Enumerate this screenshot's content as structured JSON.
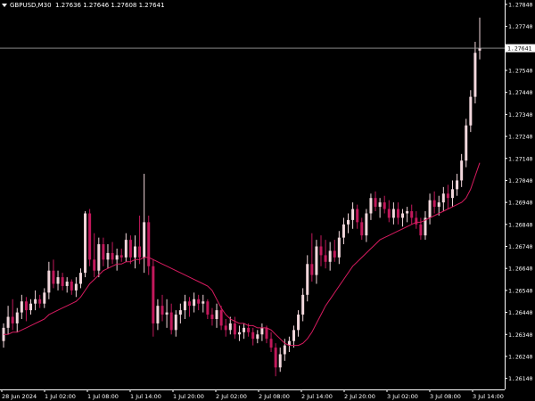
{
  "header": {
    "symbol": "GBPUSD,M30",
    "ohlc": [
      "1.27636",
      "1.27646",
      "1.27608",
      "1.27641"
    ]
  },
  "colors": {
    "background": "#000000",
    "bull": "#f2d7dc",
    "bear": "#c2185b",
    "ma": "#d81b60",
    "axis": "#ffffff",
    "priceline": "#9e9e9e"
  },
  "chart_data": {
    "type": "candlestick",
    "ylim": [
      1.2609,
      1.2786
    ],
    "y_ticks": [
      "1.27840",
      "1.27740",
      "1.27641",
      "1.27540",
      "1.27440",
      "1.27340",
      "1.27240",
      "1.27140",
      "1.27040",
      "1.26940",
      "1.26840",
      "1.26740",
      "1.26640",
      "1.26540",
      "1.26440",
      "1.26340",
      "1.26240",
      "1.26140"
    ],
    "x_ticks": [
      "28 Jun 2024",
      "1 Jul 02:00",
      "1 Jul 08:00",
      "1 Jul 14:00",
      "1 Jul 20:00",
      "2 Jul 02:00",
      "2 Jul 08:00",
      "2 Jul 14:00",
      "2 Jul 20:00",
      "3 Jul 02:00",
      "3 Jul 08:00",
      "3 Jul 14:00"
    ],
    "current_price": "1.27641",
    "candles": [
      [
        1.2631,
        1.2639,
        1.2628,
        1.2637
      ],
      [
        1.2637,
        1.2647,
        1.2634,
        1.2642
      ],
      [
        1.2642,
        1.265,
        1.2636,
        1.2639
      ],
      [
        1.2639,
        1.2646,
        1.2635,
        1.2644
      ],
      [
        1.2644,
        1.2652,
        1.2641,
        1.2649
      ],
      [
        1.2649,
        1.2651,
        1.264,
        1.2645
      ],
      [
        1.2645,
        1.265,
        1.2643,
        1.2648
      ],
      [
        1.2648,
        1.2654,
        1.2645,
        1.265
      ],
      [
        1.265,
        1.2652,
        1.2646,
        1.2648
      ],
      [
        1.2648,
        1.2655,
        1.2646,
        1.2653
      ],
      [
        1.2653,
        1.2667,
        1.265,
        1.2663
      ],
      [
        1.2663,
        1.2668,
        1.2655,
        1.2657
      ],
      [
        1.2657,
        1.2663,
        1.2654,
        1.266
      ],
      [
        1.266,
        1.2662,
        1.2654,
        1.2656
      ],
      [
        1.2656,
        1.266,
        1.2653,
        1.2658
      ],
      [
        1.2658,
        1.2659,
        1.2652,
        1.2654
      ],
      [
        1.2654,
        1.266,
        1.2651,
        1.2657
      ],
      [
        1.2657,
        1.2664,
        1.2655,
        1.2662
      ],
      [
        1.2662,
        1.269,
        1.266,
        1.2689
      ],
      [
        1.2689,
        1.2691,
        1.2665,
        1.2668
      ],
      [
        1.2668,
        1.268,
        1.266,
        1.2663
      ],
      [
        1.2663,
        1.2678,
        1.266,
        1.2675
      ],
      [
        1.2675,
        1.2678,
        1.2665,
        1.2668
      ],
      [
        1.2668,
        1.2675,
        1.2664,
        1.2671
      ],
      [
        1.2671,
        1.2676,
        1.2666,
        1.2668
      ],
      [
        1.2668,
        1.2673,
        1.2663,
        1.267
      ],
      [
        1.267,
        1.2673,
        1.2667,
        1.2669
      ],
      [
        1.2669,
        1.268,
        1.2667,
        1.2677
      ],
      [
        1.2677,
        1.2679,
        1.2666,
        1.2669
      ],
      [
        1.2669,
        1.2679,
        1.2664,
        1.2674
      ],
      [
        1.2674,
        1.2688,
        1.2666,
        1.2669
      ],
      [
        1.2669,
        1.2707,
        1.2662,
        1.2685
      ],
      [
        1.2685,
        1.2688,
        1.2661,
        1.2665
      ],
      [
        1.2665,
        1.2668,
        1.2633,
        1.2639
      ],
      [
        1.2639,
        1.265,
        1.2636,
        1.2647
      ],
      [
        1.2647,
        1.2652,
        1.264,
        1.2643
      ],
      [
        1.2643,
        1.265,
        1.2637,
        1.2644
      ],
      [
        1.2644,
        1.2648,
        1.2634,
        1.2636
      ],
      [
        1.2636,
        1.2645,
        1.2633,
        1.2643
      ],
      [
        1.2643,
        1.2648,
        1.2639,
        1.2645
      ],
      [
        1.2645,
        1.2652,
        1.2641,
        1.2649
      ],
      [
        1.2649,
        1.2651,
        1.2642,
        1.2647
      ],
      [
        1.2647,
        1.2653,
        1.2644,
        1.265
      ],
      [
        1.265,
        1.2652,
        1.2645,
        1.2648
      ],
      [
        1.2648,
        1.2652,
        1.2644,
        1.2649
      ],
      [
        1.2649,
        1.265,
        1.2641,
        1.2643
      ],
      [
        1.2643,
        1.2646,
        1.2638,
        1.2641
      ],
      [
        1.2641,
        1.2648,
        1.2637,
        1.2645
      ],
      [
        1.2645,
        1.2647,
        1.2636,
        1.2638
      ],
      [
        1.2638,
        1.2641,
        1.2633,
        1.2636
      ],
      [
        1.2636,
        1.2642,
        1.2634,
        1.2639
      ],
      [
        1.2639,
        1.2642,
        1.2632,
        1.2634
      ],
      [
        1.2634,
        1.2638,
        1.2631,
        1.2635
      ],
      [
        1.2635,
        1.2639,
        1.2632,
        1.2637
      ],
      [
        1.2637,
        1.2639,
        1.2633,
        1.2635
      ],
      [
        1.2635,
        1.2637,
        1.2629,
        1.2632
      ],
      [
        1.2632,
        1.2636,
        1.263,
        1.2634
      ],
      [
        1.2634,
        1.2639,
        1.2631,
        1.2637
      ],
      [
        1.2637,
        1.2638,
        1.263,
        1.2632
      ],
      [
        1.2632,
        1.2635,
        1.2626,
        1.2628
      ],
      [
        1.2628,
        1.263,
        1.2615,
        1.2619
      ],
      [
        1.2619,
        1.2628,
        1.2617,
        1.2625
      ],
      [
        1.2625,
        1.2632,
        1.2622,
        1.2629
      ],
      [
        1.2629,
        1.2633,
        1.2626,
        1.2631
      ],
      [
        1.2631,
        1.2638,
        1.2628,
        1.2636
      ],
      [
        1.2636,
        1.2645,
        1.2633,
        1.2643
      ],
      [
        1.2643,
        1.2655,
        1.264,
        1.2652
      ],
      [
        1.2652,
        1.267,
        1.2649,
        1.2666
      ],
      [
        1.2666,
        1.268,
        1.2658,
        1.2661
      ],
      [
        1.2661,
        1.2677,
        1.2657,
        1.2674
      ],
      [
        1.2674,
        1.2679,
        1.2665,
        1.267
      ],
      [
        1.267,
        1.2677,
        1.2664,
        1.2667
      ],
      [
        1.2667,
        1.2676,
        1.2663,
        1.2672
      ],
      [
        1.2672,
        1.2677,
        1.2667,
        1.2669
      ],
      [
        1.2669,
        1.2681,
        1.2666,
        1.2678
      ],
      [
        1.2678,
        1.2687,
        1.2675,
        1.2684
      ],
      [
        1.2684,
        1.2689,
        1.268,
        1.2686
      ],
      [
        1.2686,
        1.2694,
        1.2682,
        1.2691
      ],
      [
        1.2691,
        1.2693,
        1.2682,
        1.2685
      ],
      [
        1.2685,
        1.2687,
        1.2677,
        1.2679
      ],
      [
        1.2679,
        1.2691,
        1.2676,
        1.2689
      ],
      [
        1.2689,
        1.2698,
        1.2686,
        1.2696
      ],
      [
        1.2696,
        1.2699,
        1.269,
        1.2692
      ],
      [
        1.2692,
        1.2696,
        1.2687,
        1.2694
      ],
      [
        1.2694,
        1.2697,
        1.2689,
        1.2691
      ],
      [
        1.2691,
        1.2695,
        1.2685,
        1.2687
      ],
      [
        1.2687,
        1.2694,
        1.2684,
        1.2691
      ],
      [
        1.2691,
        1.2694,
        1.2684,
        1.2687
      ],
      [
        1.2687,
        1.2691,
        1.2683,
        1.2689
      ],
      [
        1.2689,
        1.2692,
        1.2685,
        1.269
      ],
      [
        1.269,
        1.2693,
        1.2684,
        1.2687
      ],
      [
        1.2687,
        1.269,
        1.2682,
        1.2684
      ],
      [
        1.2684,
        1.2687,
        1.2677,
        1.2679
      ],
      [
        1.2679,
        1.269,
        1.2677,
        1.2687
      ],
      [
        1.2687,
        1.2698,
        1.2684,
        1.2695
      ],
      [
        1.2695,
        1.2699,
        1.2689,
        1.2692
      ],
      [
        1.2692,
        1.2697,
        1.2688,
        1.2694
      ],
      [
        1.2694,
        1.2701,
        1.269,
        1.2698
      ],
      [
        1.2698,
        1.2702,
        1.2691,
        1.2696
      ],
      [
        1.2696,
        1.2704,
        1.2692,
        1.27
      ],
      [
        1.27,
        1.2707,
        1.2697,
        1.2704
      ],
      [
        1.2704,
        1.2716,
        1.2701,
        1.2713
      ],
      [
        1.2713,
        1.2732,
        1.271,
        1.2729
      ],
      [
        1.2729,
        1.2745,
        1.2726,
        1.2742
      ],
      [
        1.2742,
        1.2767,
        1.2739,
        1.2762
      ],
      [
        1.2763,
        1.2778,
        1.2759,
        1.2764
      ]
    ],
    "ma": [
      1.2634,
      1.2634,
      1.2635,
      1.2635,
      1.2636,
      1.2637,
      1.2638,
      1.2639,
      1.264,
      1.2641,
      1.2643,
      1.2644,
      1.2645,
      1.2646,
      1.2647,
      1.2648,
      1.2649,
      1.2651,
      1.2654,
      1.2657,
      1.2659,
      1.2661,
      1.2663,
      1.2664,
      1.2665,
      1.2666,
      1.2666,
      1.2667,
      1.2667,
      1.2668,
      1.2668,
      1.2669,
      1.2669,
      1.2668,
      1.2667,
      1.2666,
      1.2665,
      1.2664,
      1.2663,
      1.2662,
      1.2661,
      1.266,
      1.2659,
      1.2658,
      1.2657,
      1.2656,
      1.2654,
      1.265,
      1.2646,
      1.2643,
      1.2641,
      1.264,
      1.2639,
      1.2639,
      1.2638,
      1.2638,
      1.2637,
      1.2637,
      1.2637,
      1.2636,
      1.2634,
      1.2632,
      1.263,
      1.2629,
      1.2629,
      1.2629,
      1.263,
      1.2632,
      1.2635,
      1.2639,
      1.2643,
      1.2647,
      1.265,
      1.2653,
      1.2656,
      1.2659,
      1.2662,
      1.2665,
      1.2667,
      1.2669,
      1.2671,
      1.2673,
      1.2675,
      1.2677,
      1.2678,
      1.2679,
      1.268,
      1.2681,
      1.2682,
      1.2683,
      1.2684,
      1.2685,
      1.2685,
      1.2686,
      1.2687,
      1.2688,
      1.2689,
      1.269,
      1.2691,
      1.2692,
      1.2693,
      1.2694,
      1.2696,
      1.27,
      1.2706,
      1.2712
    ]
  }
}
